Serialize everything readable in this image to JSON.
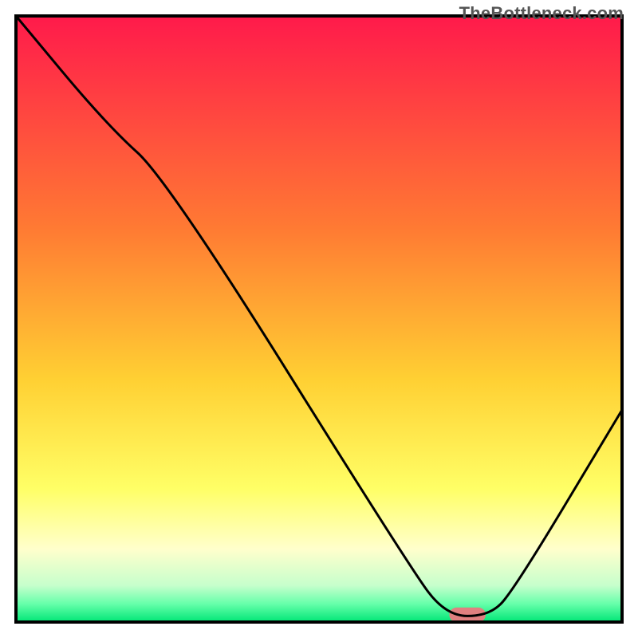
{
  "watermark": "TheBottleneck.com",
  "chart_data": {
    "type": "line",
    "title": "",
    "xlabel": "",
    "ylabel": "",
    "xlim": [
      0,
      100
    ],
    "ylim": [
      0,
      100
    ],
    "grid": false,
    "legend": false,
    "background_gradient": {
      "stops": [
        {
          "offset": 0.0,
          "color": "#ff1a4b"
        },
        {
          "offset": 0.35,
          "color": "#ff7a33"
        },
        {
          "offset": 0.6,
          "color": "#ffd033"
        },
        {
          "offset": 0.78,
          "color": "#ffff66"
        },
        {
          "offset": 0.88,
          "color": "#ffffcc"
        },
        {
          "offset": 0.94,
          "color": "#c6ffcc"
        },
        {
          "offset": 0.97,
          "color": "#66ffaa"
        },
        {
          "offset": 1.0,
          "color": "#00e676"
        }
      ]
    },
    "series": [
      {
        "name": "bottleneck-curve",
        "color": "#000000",
        "x": [
          0,
          15,
          25,
          65,
          71,
          78,
          82,
          100
        ],
        "values": [
          100,
          82,
          73,
          9,
          1,
          1,
          5,
          35
        ]
      }
    ],
    "markers": [
      {
        "name": "optimal-zone",
        "shape": "rounded-rect",
        "color": "#e08080",
        "x_center": 74.5,
        "y_center": 1.2,
        "width": 6,
        "height": 2.4
      }
    ]
  }
}
